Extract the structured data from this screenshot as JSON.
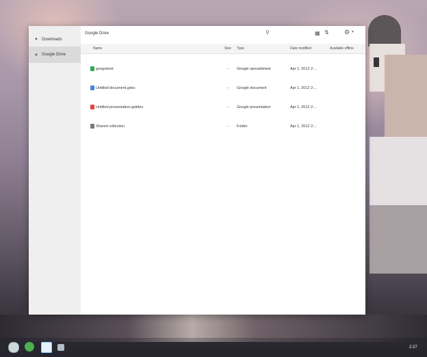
{
  "sidebar": {
    "items": [
      {
        "label": "Downloads",
        "icon": "download-icon"
      },
      {
        "label": "Google Drive",
        "icon": "drive-icon",
        "selected": true
      }
    ]
  },
  "toolbar": {
    "breadcrumb": "Google Drive"
  },
  "columns": {
    "name": "Name",
    "size": "Size",
    "type": "Type",
    "date": "Date modified",
    "avail": "Available offline"
  },
  "files": [
    {
      "name": "googsheet",
      "size": "--",
      "type": "Google spreadsheet",
      "date": "Apr 1, 2012 2:...",
      "color": "#34a853"
    },
    {
      "name": "Untitled document.gdoc",
      "size": "--",
      "type": "Google document",
      "date": "Apr 1, 2012 2:...",
      "color": "#4285f4"
    },
    {
      "name": "Untitled presentation.gslides",
      "size": "--",
      "type": "Google presentation",
      "date": "Apr 1, 2012 2:...",
      "color": "#ea4335"
    },
    {
      "name": "Shared collection",
      "size": "--",
      "type": "Folder",
      "date": "Apr 1, 2012 2:...",
      "color": "#7a7a7a"
    }
  ],
  "shelf": {
    "time": "2:27"
  }
}
